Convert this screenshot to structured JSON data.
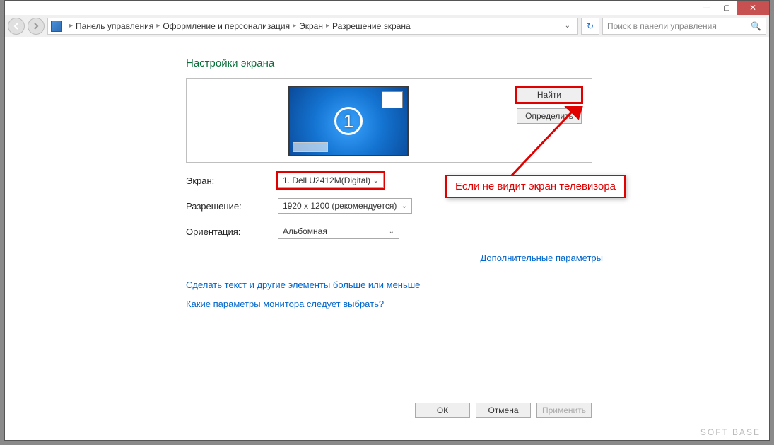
{
  "titlebar": {
    "min": "—",
    "max": "▢",
    "close": "✕"
  },
  "nav": {
    "crumbs": [
      "Панель управления",
      "Оформление и персонализация",
      "Экран",
      "Разрешение экрана"
    ],
    "search_placeholder": "Поиск в панели управления"
  },
  "page": {
    "title": "Настройки экрана",
    "monitor_number": "1",
    "find_btn": "Найти",
    "identify_btn": "Определить",
    "screen_label": "Экран:",
    "screen_value": "1. Dell U2412M(Digital)",
    "resolution_label": "Разрешение:",
    "resolution_value": "1920 x 1200 (рекомендуется)",
    "orientation_label": "Ориентация:",
    "orientation_value": "Альбомная",
    "advanced_link": "Дополнительные параметры",
    "help1": "Сделать текст и другие элементы больше или меньше",
    "help2": "Какие параметры монитора следует выбрать?"
  },
  "buttons": {
    "ok": "ОК",
    "cancel": "Отмена",
    "apply": "Применить"
  },
  "callout": "Если не видит экран телевизора",
  "watermark": "SOFT BASE"
}
